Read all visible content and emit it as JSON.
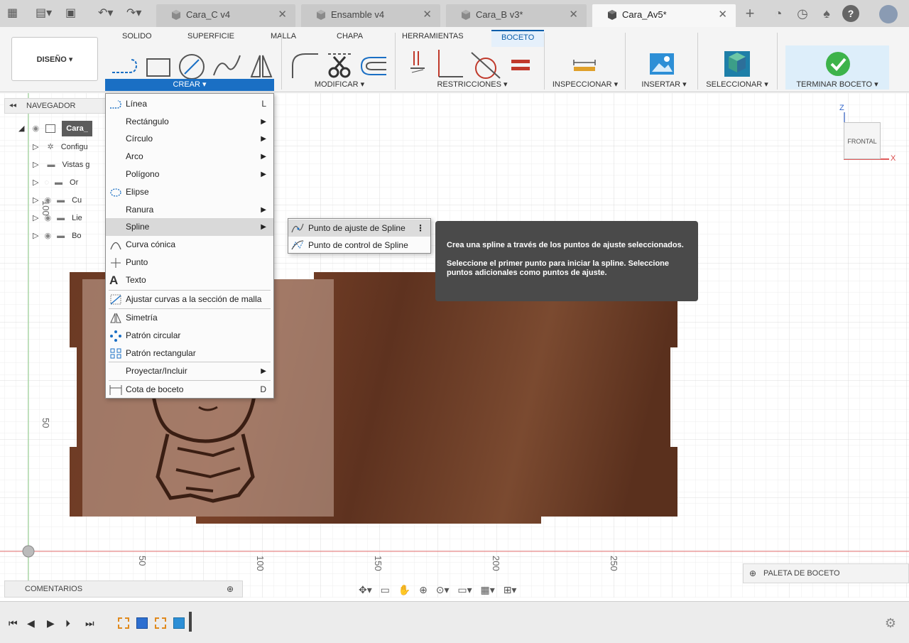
{
  "tabs": [
    {
      "label": "Cara_C v4",
      "active": false
    },
    {
      "label": "Ensamble v4",
      "active": false
    },
    {
      "label": "Cara_B v3*",
      "active": false
    },
    {
      "label": "Cara_Av5*",
      "active": true
    }
  ],
  "ribbon": {
    "tabs": [
      "SOLIDO",
      "SUPERFICIE",
      "MALLA",
      "CHAPA",
      "HERRAMIENTAS",
      "BOCETO"
    ],
    "active_tab": "BOCETO",
    "design_label": "DISEÑO ▾",
    "groups": {
      "crear": "CREAR ▾",
      "modificar": "MODIFICAR ▾",
      "restricciones": "RESTRICCIONES ▾",
      "inspeccionar": "INSPECCIONAR ▾",
      "insertar": "INSERTAR ▾",
      "seleccionar": "SELECCIONAR ▾",
      "terminar": "TERMINAR BOCETO ▾"
    }
  },
  "navigator": {
    "title": "NAVEGADOR",
    "rows": [
      "Cara_",
      "Configu",
      "Vistas g",
      "Or",
      "Cu",
      "Lie",
      "Bo"
    ]
  },
  "menu": {
    "items": [
      {
        "label": "Línea",
        "shortcut": "L",
        "submenu": false
      },
      {
        "label": "Rectángulo",
        "shortcut": "",
        "submenu": true
      },
      {
        "label": "Círculo",
        "shortcut": "",
        "submenu": true
      },
      {
        "label": "Arco",
        "shortcut": "",
        "submenu": true
      },
      {
        "label": "Polígono",
        "shortcut": "",
        "submenu": true
      },
      {
        "label": "Elipse",
        "shortcut": "",
        "submenu": false
      },
      {
        "label": "Ranura",
        "shortcut": "",
        "submenu": true
      },
      {
        "label": "Spline",
        "shortcut": "",
        "submenu": true
      },
      {
        "label": "Curva cónica",
        "shortcut": "",
        "submenu": false
      },
      {
        "label": "Punto",
        "shortcut": "",
        "submenu": false
      },
      {
        "label": "Texto",
        "shortcut": "",
        "submenu": false
      },
      {
        "label": "Ajustar curvas a la sección de malla",
        "shortcut": "",
        "submenu": false
      },
      {
        "label": "Simetría",
        "shortcut": "",
        "submenu": false
      },
      {
        "label": "Patrón circular",
        "shortcut": "",
        "submenu": false
      },
      {
        "label": "Patrón rectangular",
        "shortcut": "",
        "submenu": false
      },
      {
        "label": "Proyectar/Incluir",
        "shortcut": "",
        "submenu": true
      },
      {
        "label": "Cota de boceto",
        "shortcut": "D",
        "submenu": false
      }
    ]
  },
  "submenu": {
    "items": [
      "Punto de ajuste de Spline",
      "Punto de control de Spline"
    ]
  },
  "tooltip": {
    "line1": "Crea una spline a través de los puntos de ajuste seleccionados.",
    "line2": "Seleccione el primer punto para iniciar la spline. Seleccione puntos adicionales como puntos de ajuste."
  },
  "viewcube_label": "FRONTAL",
  "axes": {
    "z": "Z",
    "x": "X"
  },
  "ruler": {
    "vertical": [
      "100",
      "50"
    ],
    "horizontal": [
      "50",
      "100",
      "150",
      "200",
      "250"
    ]
  },
  "bottom": {
    "comments": "COMENTARIOS",
    "palette": "PALETA DE BOCETO"
  }
}
